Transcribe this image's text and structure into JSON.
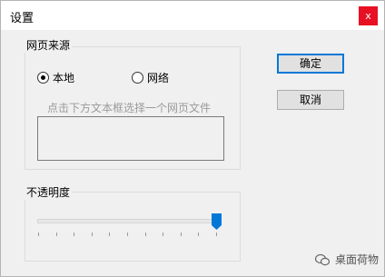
{
  "window": {
    "title": "设置",
    "close_label": "x"
  },
  "source_group": {
    "label": "网页来源",
    "options": [
      {
        "label": "本地",
        "checked": true
      },
      {
        "label": "网络",
        "checked": false
      }
    ],
    "hint": "点击下方文本框选择一个网页文件",
    "file_box_value": ""
  },
  "opacity_group": {
    "label": "不透明度",
    "value_fraction": 1.0,
    "tick_count": 11
  },
  "buttons": {
    "ok": "确定",
    "cancel": "取消"
  },
  "watermark": {
    "text": "桌面荷物"
  },
  "colors": {
    "accent": "#0078d7",
    "close": "#e81123"
  }
}
